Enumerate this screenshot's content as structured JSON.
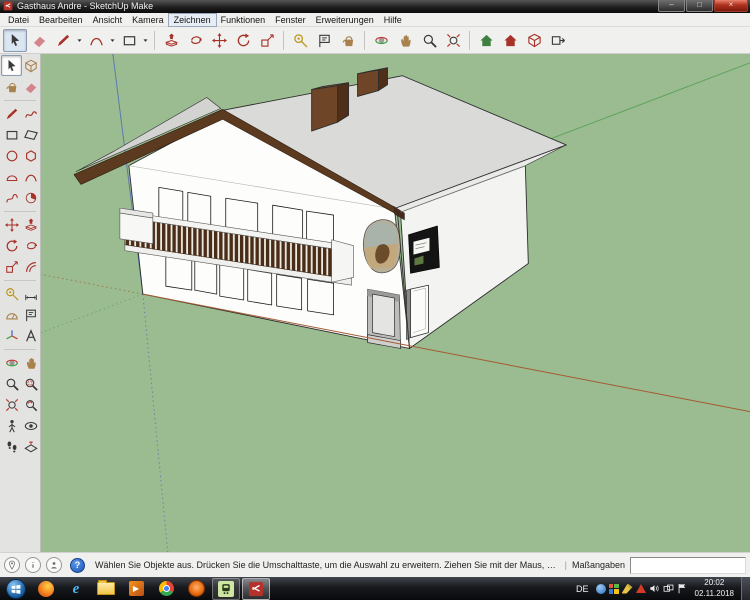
{
  "window": {
    "title": "Gasthaus Andre - SketchUp Make",
    "controls": {
      "minimize": "–",
      "maximize": "□",
      "close": "×"
    }
  },
  "menu_bar": {
    "items": [
      "Datei",
      "Bearbeiten",
      "Ansicht",
      "Kamera",
      "Zeichnen",
      "Funktionen",
      "Fenster",
      "Erweiterungen",
      "Hilfe"
    ],
    "active_item": "Zeichnen"
  },
  "toolbar": {
    "active_tool": "select",
    "tools": [
      "select",
      "eraser",
      "line",
      "arc",
      "rectangle",
      "push-pull",
      "follow-me",
      "move",
      "rotate",
      "scale",
      "tape-measure",
      "text",
      "paint-bucket",
      "orbit",
      "pan",
      "zoom",
      "zoom-extents",
      "get-models",
      "share-model",
      "share-component",
      "send-to-layout"
    ]
  },
  "tool_palette": {
    "active_tool": "select",
    "tools": [
      "select",
      "make-component",
      "paint-bucket",
      "eraser",
      "line",
      "freehand",
      "rectangle",
      "rotated-rectangle",
      "circle",
      "polygon",
      "two-point-arc",
      "arc",
      "three-point-arc",
      "pie",
      "move",
      "push-pull",
      "rotate",
      "follow-me",
      "scale",
      "offset",
      "tape-measure",
      "dimensions",
      "protractor",
      "text",
      "axes",
      "3d-text",
      "orbit",
      "pan",
      "zoom",
      "zoom-window",
      "zoom-extents",
      "zoom-previous",
      "position-camera",
      "look-around",
      "walk",
      "section-plane"
    ]
  },
  "scene": {
    "description": "Perspective view of a two-story white gabled guesthouse with wooden balcony, gray roof, two brown chimneys, oval wall painting and black wall sign on green ground with drawing axes",
    "parts": [
      "roof",
      "front wall",
      "side wall",
      "gable fascia",
      "chimneys",
      "balcony",
      "windows",
      "entrance doorway",
      "side door",
      "wall sign",
      "oval painting"
    ],
    "colors": {
      "ground": "#9BBC90",
      "wall_front": "#FDFDFC",
      "wall_side": "#F3F3F1",
      "roof": "#DADAD9",
      "soffit": "#EAEAE8",
      "fascia": "#5C3A20",
      "chimney": "#6E4526",
      "balcony_slats": "#4A2D18",
      "axis_red": "#A35A33",
      "axis_green": "#5FA45F",
      "axis_blue": "#5B79B0"
    }
  },
  "status_bar": {
    "hint": "Wählen Sie Objekte aus. Drücken Sie die Umschalttaste, um die Auswahl zu erweitern. Ziehen Sie mit der Maus, um mehrere Objekte auszuwä...",
    "separator": "|",
    "measure_label": "Maßangaben",
    "measure_value": "",
    "help_glyph": "?",
    "icons": [
      "geolocation",
      "credits",
      "sign-in",
      "context-help"
    ]
  },
  "taskbar": {
    "language": "DE",
    "time": "20:02",
    "date": "02.11.2018",
    "ie_glyph": "e",
    "wmp_glyph": "▶",
    "icons": [
      "start",
      "firefox",
      "internet-explorer",
      "windows-explorer",
      "windows-media-player",
      "chrome",
      "orange-app",
      "train-app",
      "sketchup"
    ],
    "tray_icons": [
      "tray-app-blue",
      "tray-app-grid",
      "tray-cleaner",
      "tray-app-red",
      "volume",
      "network",
      "action-center-flag"
    ]
  }
}
